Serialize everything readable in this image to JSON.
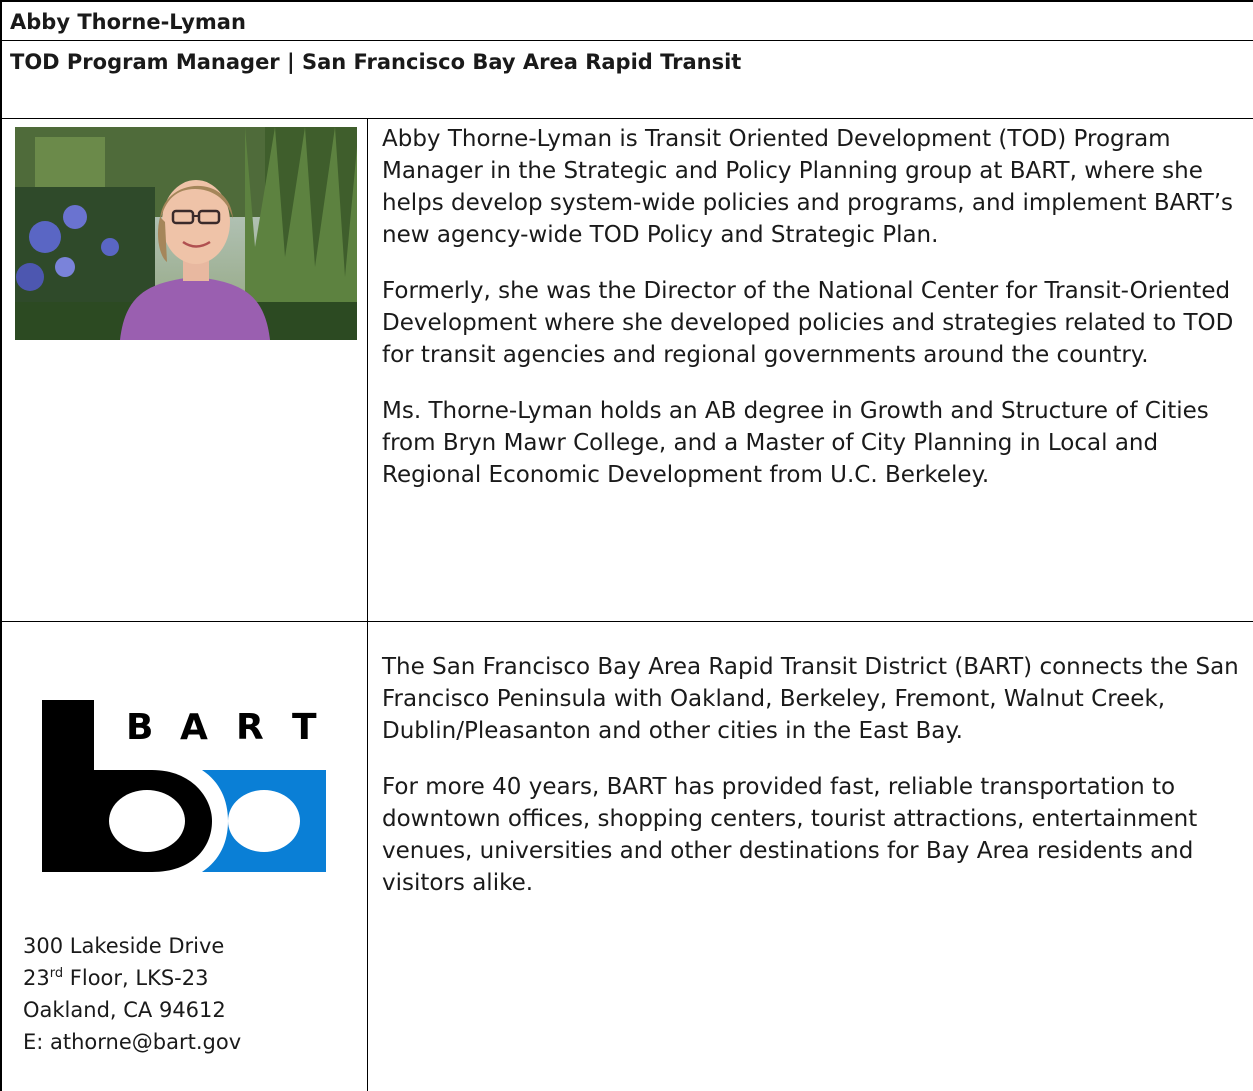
{
  "header": {
    "name": "Abby Thorne-Lyman",
    "title": "TOD Program Manager | San Francisco Bay Area Rapid Transit"
  },
  "bio": {
    "paragraphs": [
      "Abby Thorne-Lyman is Transit Oriented Development (TOD) Program Manager in the Strategic and Policy Planning group at BART, where she helps develop system-wide policies and programs, and implement BART’s new agency-wide TOD Policy and Strategic Plan.",
      "Formerly, she was the Director of the National Center for Transit-Oriented Development where she developed policies and strategies related to TOD for transit agencies and regional governments around the country.",
      "Ms. Thorne-Lyman holds an AB degree in Growth and Structure of Cities from Bryn Mawr College, and a Master of City Planning in Local and Regional Economic Development from U.C. Berkeley."
    ]
  },
  "org": {
    "logo_text": "BART",
    "logo_colors": {
      "black": "#000000",
      "blue": "#0a7fd6"
    },
    "about": [
      "The San Francisco Bay Area Rapid Transit District (BART) connects the San Francisco Peninsula with Oakland, Berkeley, Fremont, Walnut Creek, Dublin/Pleasanton and other cities in the East Bay.",
      "For more 40 years, BART has provided fast, reliable transportation to downtown offices, shopping centers, tourist attractions, entertainment venues, universities and other destinations for Bay Area residents and visitors alike."
    ],
    "address": {
      "street": "300 Lakeside Drive",
      "floor_num": "23",
      "floor_sup": "rd",
      "floor_rest": " Floor, LKS-23",
      "city": "Oakland, CA 94612",
      "email": "E: athorne@bart.gov"
    }
  }
}
